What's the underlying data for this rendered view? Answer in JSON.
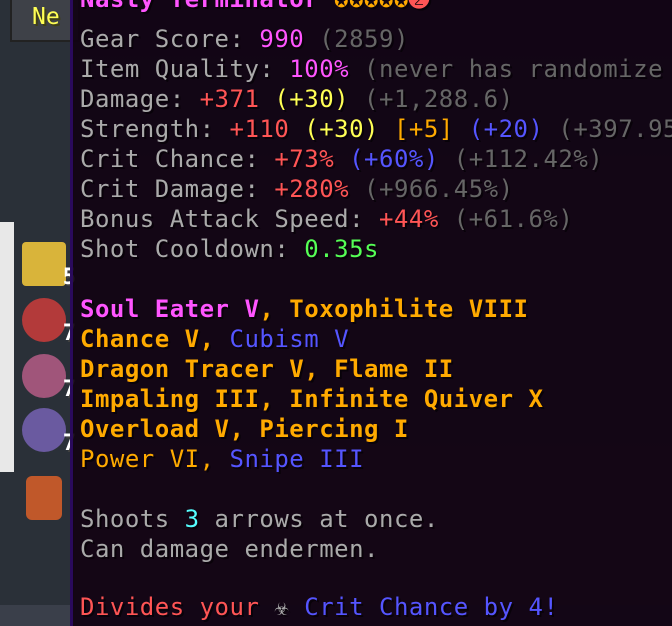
{
  "tooltip": {
    "title": "Nasty Terminator",
    "stats": {
      "gear_score": {
        "label": "Gear Score: ",
        "value": "990",
        "extra": "(2859)"
      },
      "item_quality": {
        "label": "Item Quality: ",
        "value": "100%",
        "extra": "(never has randomize"
      },
      "damage": {
        "label": "Damage: ",
        "value": "+371",
        "bonus": "(+30)",
        "extra": "(+1,288.6)"
      },
      "strength": {
        "label": "Strength: ",
        "value": "+110",
        "bonus": "(+30)",
        "bonus2": "[+5]",
        "bonus3": "(+20)",
        "extra": "(+397.95"
      },
      "crit_chance": {
        "label": "Crit Chance: ",
        "value": "+73%",
        "bonus": "(+60%)",
        "extra": "(+112.42%)"
      },
      "crit_damage": {
        "label": "Crit Damage: ",
        "value": "+280%",
        "extra": "(+966.45%)"
      },
      "attack_speed": {
        "label": "Bonus Attack Speed: ",
        "value": "+44%",
        "extra": "(+61.6%)"
      },
      "shot_cooldown": {
        "label": "Shot Cooldown: ",
        "value": "0.35s"
      }
    },
    "enchants": [
      [
        "Soul Eater V",
        ", ",
        "Toxophilite VIII"
      ],
      [
        "Chance V",
        ", ",
        "Cubism V"
      ],
      [
        "Dragon Tracer V, Flame II"
      ],
      [
        "Impaling III, Infinite Quiver X"
      ],
      [
        "Overload V, Piercing I"
      ],
      [
        "Power VI",
        ", ",
        "Snipe III"
      ]
    ],
    "lore": {
      "shoots_prefix": "Shoots ",
      "shoots_count": "3",
      "shoots_suffix": " arrows at once.",
      "endermen": "Can damage endermen.",
      "ability_partial": "Divides your",
      "ability_partial2": "Crit Chance by 4!"
    }
  },
  "inventory": {
    "next_label": "Ne",
    "slots": [
      {
        "icon": "sponge-icon",
        "count": "5"
      },
      {
        "icon": "chestplate-icon",
        "count": "7"
      },
      {
        "icon": "leggings-icon",
        "count": "7"
      },
      {
        "icon": "leggings-icon",
        "count": "7"
      },
      {
        "icon": "boots-icon",
        "count": ""
      }
    ]
  },
  "colors": {
    "tooltip_bg": "#100212",
    "tooltip_border": "#2a0a5c",
    "stat_label": "#aaaaaa",
    "stat_value_pink": "#ff55ff",
    "stat_value_red": "#ff5555",
    "reforge_yellow": "#ffff55",
    "gem_blue": "#5555ff",
    "enchant_gold": "#ffaa00",
    "cooldown_green": "#55ff55"
  }
}
